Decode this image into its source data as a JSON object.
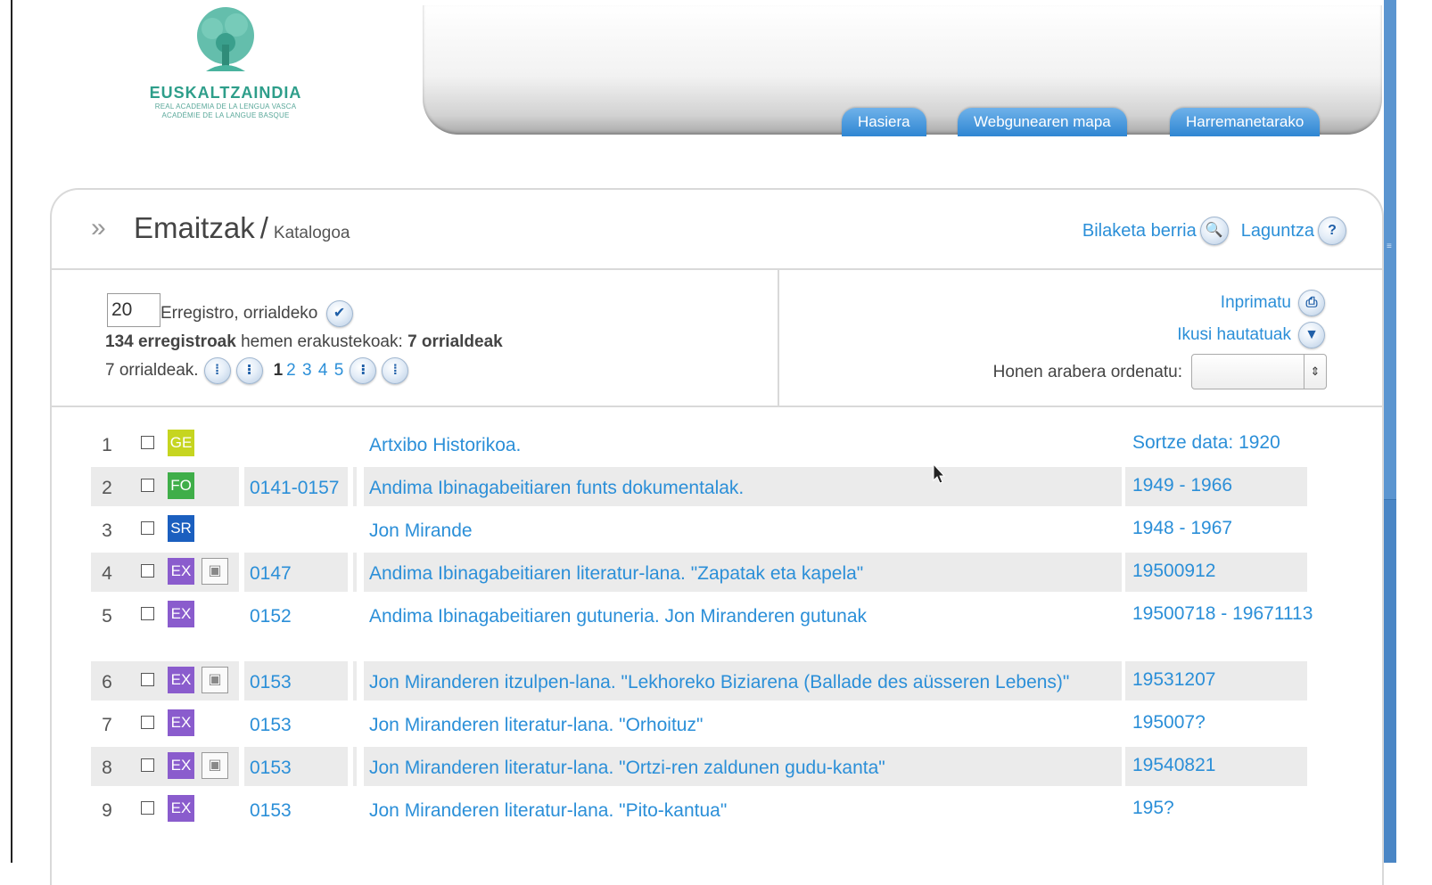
{
  "logo": {
    "name": "EUSKALTZAINDIA",
    "sub1": "REAL ACADEMIA DE LA LENGUA VASCA",
    "sub2": "ACADÉMIE DE LA LANGUE BASQUE",
    "icon": "tree-emblem-icon"
  },
  "nav": {
    "tabs": [
      "Hasiera",
      "Webgunearen mapa",
      "Harremanetarako"
    ]
  },
  "page": {
    "title": "Emaitzak",
    "separator": "/",
    "subtitle": "Katalogoa",
    "new_search": "Bilaketa berria",
    "help": "Laguntza"
  },
  "controls": {
    "per_page_value": "20",
    "per_page_label": "Erregistro, orrialdeko",
    "records_bold": "134 erregistroak",
    "records_mid": "hemen erakustekoak:",
    "records_pages": "7 orrialdeak",
    "pages_label": "7 orrialdeak.",
    "current_page": "1",
    "page_links": [
      "2",
      "3",
      "4",
      "5"
    ],
    "print": "Inprimatu",
    "view_selected": "Ikusi hautatuak",
    "sort_label": "Honen arabera ordenatu:",
    "sort_value": ""
  },
  "colors": {
    "link": "#2b8fd8",
    "GE": "#c6d520",
    "FO": "#3fae49",
    "SR": "#1b5fbf",
    "EX": "#8a5ccd",
    "tab": "#2f86d2",
    "row_alt": "#ebebeb"
  },
  "results": [
    {
      "num": "1",
      "badge": "GE",
      "image": false,
      "code": "",
      "title": "Artxibo Historikoa.",
      "date": "Sortze data: 1920"
    },
    {
      "num": "2",
      "badge": "FO",
      "image": false,
      "code": "0141-0157",
      "title": "Andima Ibinagabeitiaren funts dokumentalak.",
      "date": "1949 - 1966"
    },
    {
      "num": "3",
      "badge": "SR",
      "image": false,
      "code": "",
      "title": "Jon Mirande",
      "date": "1948 - 1967"
    },
    {
      "num": "4",
      "badge": "EX",
      "image": true,
      "code": "0147",
      "title": "Andima Ibinagabeitiaren literatur-lana. \"Zapatak eta kapela\"",
      "date": "19500912"
    },
    {
      "num": "5",
      "badge": "EX",
      "image": false,
      "code": "0152",
      "title": "Andima Ibinagabeitiaren gutuneria. Jon Miranderen gutunak",
      "date": "19500718 - 19671113"
    },
    {
      "num": "6",
      "badge": "EX",
      "image": true,
      "code": "0153",
      "title": "Jon Miranderen itzulpen-lana. \"Lekhoreko Biziarena (Ballade des aüsseren Lebens)\"",
      "date": "19531207"
    },
    {
      "num": "7",
      "badge": "EX",
      "image": false,
      "code": "0153",
      "title": "Jon Miranderen literatur-lana. \"Orhoituz\"",
      "date": "195007?"
    },
    {
      "num": "8",
      "badge": "EX",
      "image": true,
      "code": "0153",
      "title": "Jon Miranderen literatur-lana. \"Ortzi-ren zaldunen gudu-kanta\"",
      "date": "19540821"
    },
    {
      "num": "9",
      "badge": "EX",
      "image": false,
      "code": "0153",
      "title": "Jon Miranderen literatur-lana. \"Pito-kantua\"",
      "date": "195?"
    }
  ]
}
